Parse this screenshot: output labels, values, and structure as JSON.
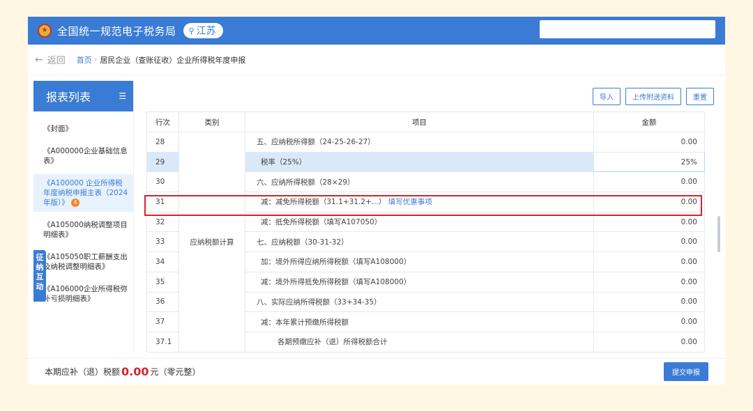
{
  "header": {
    "emblem_icon": "tax-emblem-icon",
    "title": "全国统一规范电子税务局",
    "region": "江苏",
    "brand_color": "#3a7bd5"
  },
  "breadcrumb": {
    "back": "返回",
    "home": "首页",
    "sep": "›",
    "current": "居民企业（查账征收）企业所得税年度申报"
  },
  "sidebar": {
    "title": "报表列表",
    "items": [
      {
        "label": "《封面》"
      },
      {
        "label": "《A000000企业基础信息表》"
      },
      {
        "label": "《A100000 企业所得税年度纳税申报主表（2024年版）》",
        "badge": "4"
      },
      {
        "label": "《A105000纳税调整项目明细表》"
      },
      {
        "label": "《A105050职工薪酬支出及纳税调整明细表》"
      },
      {
        "label": "《A106000企业所得税弥补亏损明细表》"
      }
    ],
    "float_tab": "征纳互动"
  },
  "toolbar": {
    "import": "导入",
    "upload": "上传附送资料",
    "reset": "重置"
  },
  "table": {
    "headers": [
      "行次",
      "类别",
      "项目",
      "金额"
    ],
    "category": "应纳税额计算",
    "rows": [
      {
        "no": "28",
        "item": "五、应纳税所得额（24-25-26-27）",
        "amount": "0.00"
      },
      {
        "no": "29",
        "item": "税率（25%）",
        "amount": "25%"
      },
      {
        "no": "30",
        "item": "六、应纳所得税额（28×29）",
        "amount": "0.00"
      },
      {
        "no": "31",
        "item": "减：减免所得税额（31.1+31.2+...）",
        "link": "填写优惠事项",
        "amount": "0.00"
      },
      {
        "no": "32",
        "item": "减：抵免所得税额（填写A107050）",
        "amount": "0.00"
      },
      {
        "no": "33",
        "item": "七、应纳税额（30-31-32）",
        "amount": "0.00"
      },
      {
        "no": "34",
        "item": "加：境外所得应纳所得税额（填写A108000）",
        "amount": "0.00"
      },
      {
        "no": "35",
        "item": "减：境外所得抵免所得税额（填写A108000）",
        "amount": "0.00"
      },
      {
        "no": "36",
        "item": "八、实际应纳所得税额（33+34-35）",
        "amount": "0.00"
      },
      {
        "no": "37",
        "item": "减：本年累计预缴所得税额",
        "amount": "0.00"
      },
      {
        "no": "37.1",
        "item": "各期预缴应补（退）所得税额合计",
        "amount": "0.00"
      }
    ]
  },
  "footer": {
    "label": "本期应补（退）税额",
    "amount": "0.00",
    "unit": "元（零元整）",
    "submit": "提交申报"
  }
}
